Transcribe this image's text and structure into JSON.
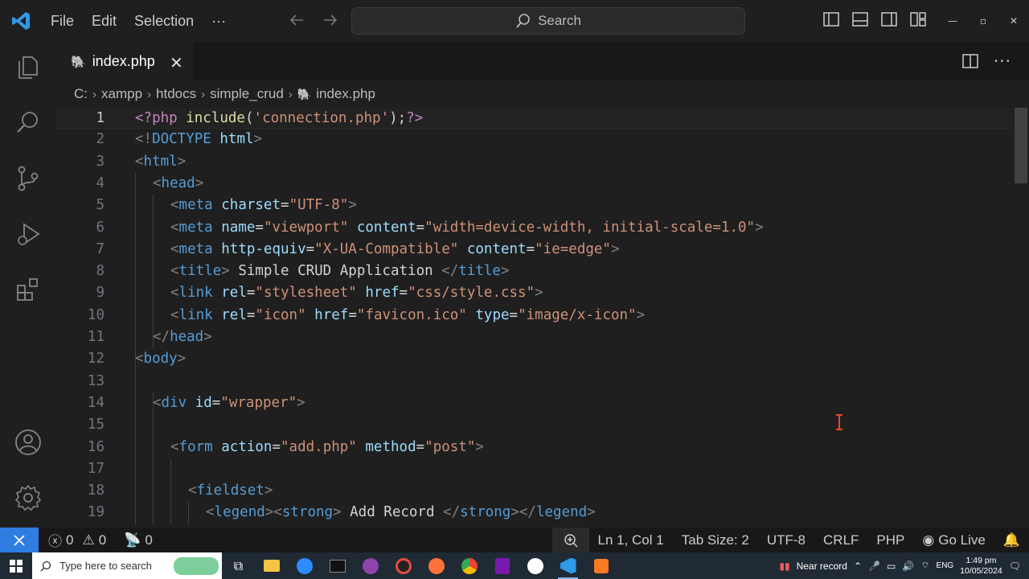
{
  "titlebar": {
    "menu": [
      "File",
      "Edit",
      "Selection",
      "···"
    ],
    "search_placeholder": "Search"
  },
  "tab": {
    "filename": "index.php"
  },
  "breadcrumb": [
    "C:",
    "xampp",
    "htdocs",
    "simple_crud",
    "index.php"
  ],
  "editor": {
    "lines": [
      {
        "n": "1",
        "indent": 0,
        "tokens": [
          [
            "php",
            "<?php "
          ],
          [
            "fn",
            "include"
          ],
          [
            "txt",
            "("
          ],
          [
            "str",
            "'connection.php'"
          ],
          [
            "txt",
            ");"
          ],
          [
            "php",
            "?>"
          ]
        ]
      },
      {
        "n": "2",
        "indent": 0,
        "tokens": [
          [
            "pun",
            "<!"
          ],
          [
            "tag",
            "DOCTYPE"
          ],
          [
            "txt",
            " "
          ],
          [
            "attr",
            "html"
          ],
          [
            "pun",
            ">"
          ]
        ]
      },
      {
        "n": "3",
        "indent": 0,
        "tokens": [
          [
            "pun",
            "<"
          ],
          [
            "tag",
            "html"
          ],
          [
            "pun",
            ">"
          ]
        ]
      },
      {
        "n": "4",
        "indent": 1,
        "tokens": [
          [
            "pun",
            "<"
          ],
          [
            "tag",
            "head"
          ],
          [
            "pun",
            ">"
          ]
        ]
      },
      {
        "n": "5",
        "indent": 2,
        "tokens": [
          [
            "pun",
            "<"
          ],
          [
            "tag",
            "meta"
          ],
          [
            "txt",
            " "
          ],
          [
            "attr",
            "charset"
          ],
          [
            "txt",
            "="
          ],
          [
            "str",
            "\"UTF-8\""
          ],
          [
            "pun",
            ">"
          ]
        ]
      },
      {
        "n": "6",
        "indent": 2,
        "tokens": [
          [
            "pun",
            "<"
          ],
          [
            "tag",
            "meta"
          ],
          [
            "txt",
            " "
          ],
          [
            "attr",
            "name"
          ],
          [
            "txt",
            "="
          ],
          [
            "str",
            "\"viewport\""
          ],
          [
            "txt",
            " "
          ],
          [
            "attr",
            "content"
          ],
          [
            "txt",
            "="
          ],
          [
            "str",
            "\"width=device-width, initial-scale=1.0\""
          ],
          [
            "pun",
            ">"
          ]
        ]
      },
      {
        "n": "7",
        "indent": 2,
        "tokens": [
          [
            "pun",
            "<"
          ],
          [
            "tag",
            "meta"
          ],
          [
            "txt",
            " "
          ],
          [
            "attr",
            "http-equiv"
          ],
          [
            "txt",
            "="
          ],
          [
            "str",
            "\"X-UA-Compatible\""
          ],
          [
            "txt",
            " "
          ],
          [
            "attr",
            "content"
          ],
          [
            "txt",
            "="
          ],
          [
            "str",
            "\"ie=edge\""
          ],
          [
            "pun",
            ">"
          ]
        ]
      },
      {
        "n": "8",
        "indent": 2,
        "tokens": [
          [
            "pun",
            "<"
          ],
          [
            "tag",
            "title"
          ],
          [
            "pun",
            ">"
          ],
          [
            "txt",
            " Simple CRUD Application "
          ],
          [
            "pun",
            "</"
          ],
          [
            "tag",
            "title"
          ],
          [
            "pun",
            ">"
          ]
        ]
      },
      {
        "n": "9",
        "indent": 2,
        "tokens": [
          [
            "pun",
            "<"
          ],
          [
            "tag",
            "link"
          ],
          [
            "txt",
            " "
          ],
          [
            "attr",
            "rel"
          ],
          [
            "txt",
            "="
          ],
          [
            "str",
            "\"stylesheet\""
          ],
          [
            "txt",
            " "
          ],
          [
            "attr",
            "href"
          ],
          [
            "txt",
            "="
          ],
          [
            "str",
            "\"css/style.css\""
          ],
          [
            "pun",
            ">"
          ]
        ]
      },
      {
        "n": "10",
        "indent": 2,
        "tokens": [
          [
            "pun",
            "<"
          ],
          [
            "tag",
            "link"
          ],
          [
            "txt",
            " "
          ],
          [
            "attr",
            "rel"
          ],
          [
            "txt",
            "="
          ],
          [
            "str",
            "\"icon\""
          ],
          [
            "txt",
            " "
          ],
          [
            "attr",
            "href"
          ],
          [
            "txt",
            "="
          ],
          [
            "str",
            "\"favicon.ico\""
          ],
          [
            "txt",
            " "
          ],
          [
            "attr",
            "type"
          ],
          [
            "txt",
            "="
          ],
          [
            "str",
            "\"image/x-icon\""
          ],
          [
            "pun",
            ">"
          ]
        ]
      },
      {
        "n": "11",
        "indent": 1,
        "tokens": [
          [
            "pun",
            "</"
          ],
          [
            "tag",
            "head"
          ],
          [
            "pun",
            ">"
          ]
        ]
      },
      {
        "n": "12",
        "indent": 0,
        "tokens": [
          [
            "pun",
            "<"
          ],
          [
            "tag",
            "body"
          ],
          [
            "pun",
            ">"
          ]
        ]
      },
      {
        "n": "13",
        "indent": 0,
        "tokens": []
      },
      {
        "n": "14",
        "indent": 1,
        "tokens": [
          [
            "pun",
            "<"
          ],
          [
            "tag",
            "div"
          ],
          [
            "txt",
            " "
          ],
          [
            "attr",
            "id"
          ],
          [
            "txt",
            "="
          ],
          [
            "str",
            "\"wrapper\""
          ],
          [
            "pun",
            ">"
          ]
        ]
      },
      {
        "n": "15",
        "indent": 0,
        "tokens": []
      },
      {
        "n": "16",
        "indent": 2,
        "tokens": [
          [
            "pun",
            "<"
          ],
          [
            "tag",
            "form"
          ],
          [
            "txt",
            " "
          ],
          [
            "attr",
            "action"
          ],
          [
            "txt",
            "="
          ],
          [
            "str",
            "\"add.php\""
          ],
          [
            "txt",
            " "
          ],
          [
            "attr",
            "method"
          ],
          [
            "txt",
            "="
          ],
          [
            "str",
            "\"post\""
          ],
          [
            "pun",
            ">"
          ]
        ]
      },
      {
        "n": "17",
        "indent": 0,
        "tokens": []
      },
      {
        "n": "18",
        "indent": 3,
        "tokens": [
          [
            "pun",
            "<"
          ],
          [
            "tag",
            "fieldset"
          ],
          [
            "pun",
            ">"
          ]
        ]
      },
      {
        "n": "19",
        "indent": 4,
        "tokens": [
          [
            "pun",
            "<"
          ],
          [
            "tag",
            "legend"
          ],
          [
            "pun",
            "><"
          ],
          [
            "tag",
            "strong"
          ],
          [
            "pun",
            ">"
          ],
          [
            "txt",
            " Add Record "
          ],
          [
            "pun",
            "</"
          ],
          [
            "tag",
            "strong"
          ],
          [
            "pun",
            "></"
          ],
          [
            "tag",
            "legend"
          ],
          [
            "pun",
            ">"
          ]
        ]
      }
    ]
  },
  "statusbar": {
    "errors": "0",
    "warnings": "0",
    "ports": "0",
    "position": "Ln 1, Col 1",
    "tab_size": "Tab Size: 2",
    "encoding": "UTF-8",
    "eol": "CRLF",
    "language": "PHP",
    "go_live": "Go Live"
  },
  "taskbar": {
    "search_placeholder": "Type here to search",
    "tray_label": "Near record",
    "lang": "ENG",
    "time": "1:49 pm",
    "date": "10/05/2024"
  }
}
